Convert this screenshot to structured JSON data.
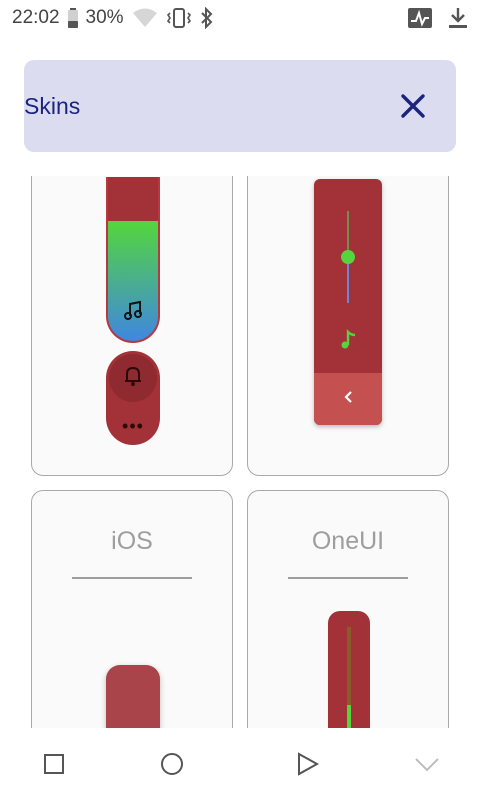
{
  "status_bar": {
    "time": "22:02",
    "battery": "30%",
    "icons": [
      "battery-icon",
      "wifi-icon",
      "vibrate-icon",
      "bluetooth-icon",
      "activity-icon",
      "download-icon"
    ]
  },
  "header": {
    "title": "Skins",
    "close_icon": "close-icon",
    "background": "#dcdcf0",
    "title_color": "#1a237e"
  },
  "skins": [
    {
      "title": "",
      "volume_level": 0.73,
      "icons": [
        "music-note-icon",
        "bell-icon",
        "more-dots-icon"
      ]
    },
    {
      "title": "",
      "volume_level": 0.5,
      "icons": [
        "music-note-icon",
        "chevron-left-icon"
      ]
    },
    {
      "title": "iOS"
    },
    {
      "title": "OneUI"
    }
  ],
  "more_dots": "•••",
  "colors": {
    "accent_red": "#a33238",
    "green": "#56d43c",
    "blue": "#3f87e0"
  },
  "nav_bar": {
    "icons": [
      "square-icon",
      "circle-icon",
      "play-icon",
      "chevron-down-icon"
    ]
  }
}
